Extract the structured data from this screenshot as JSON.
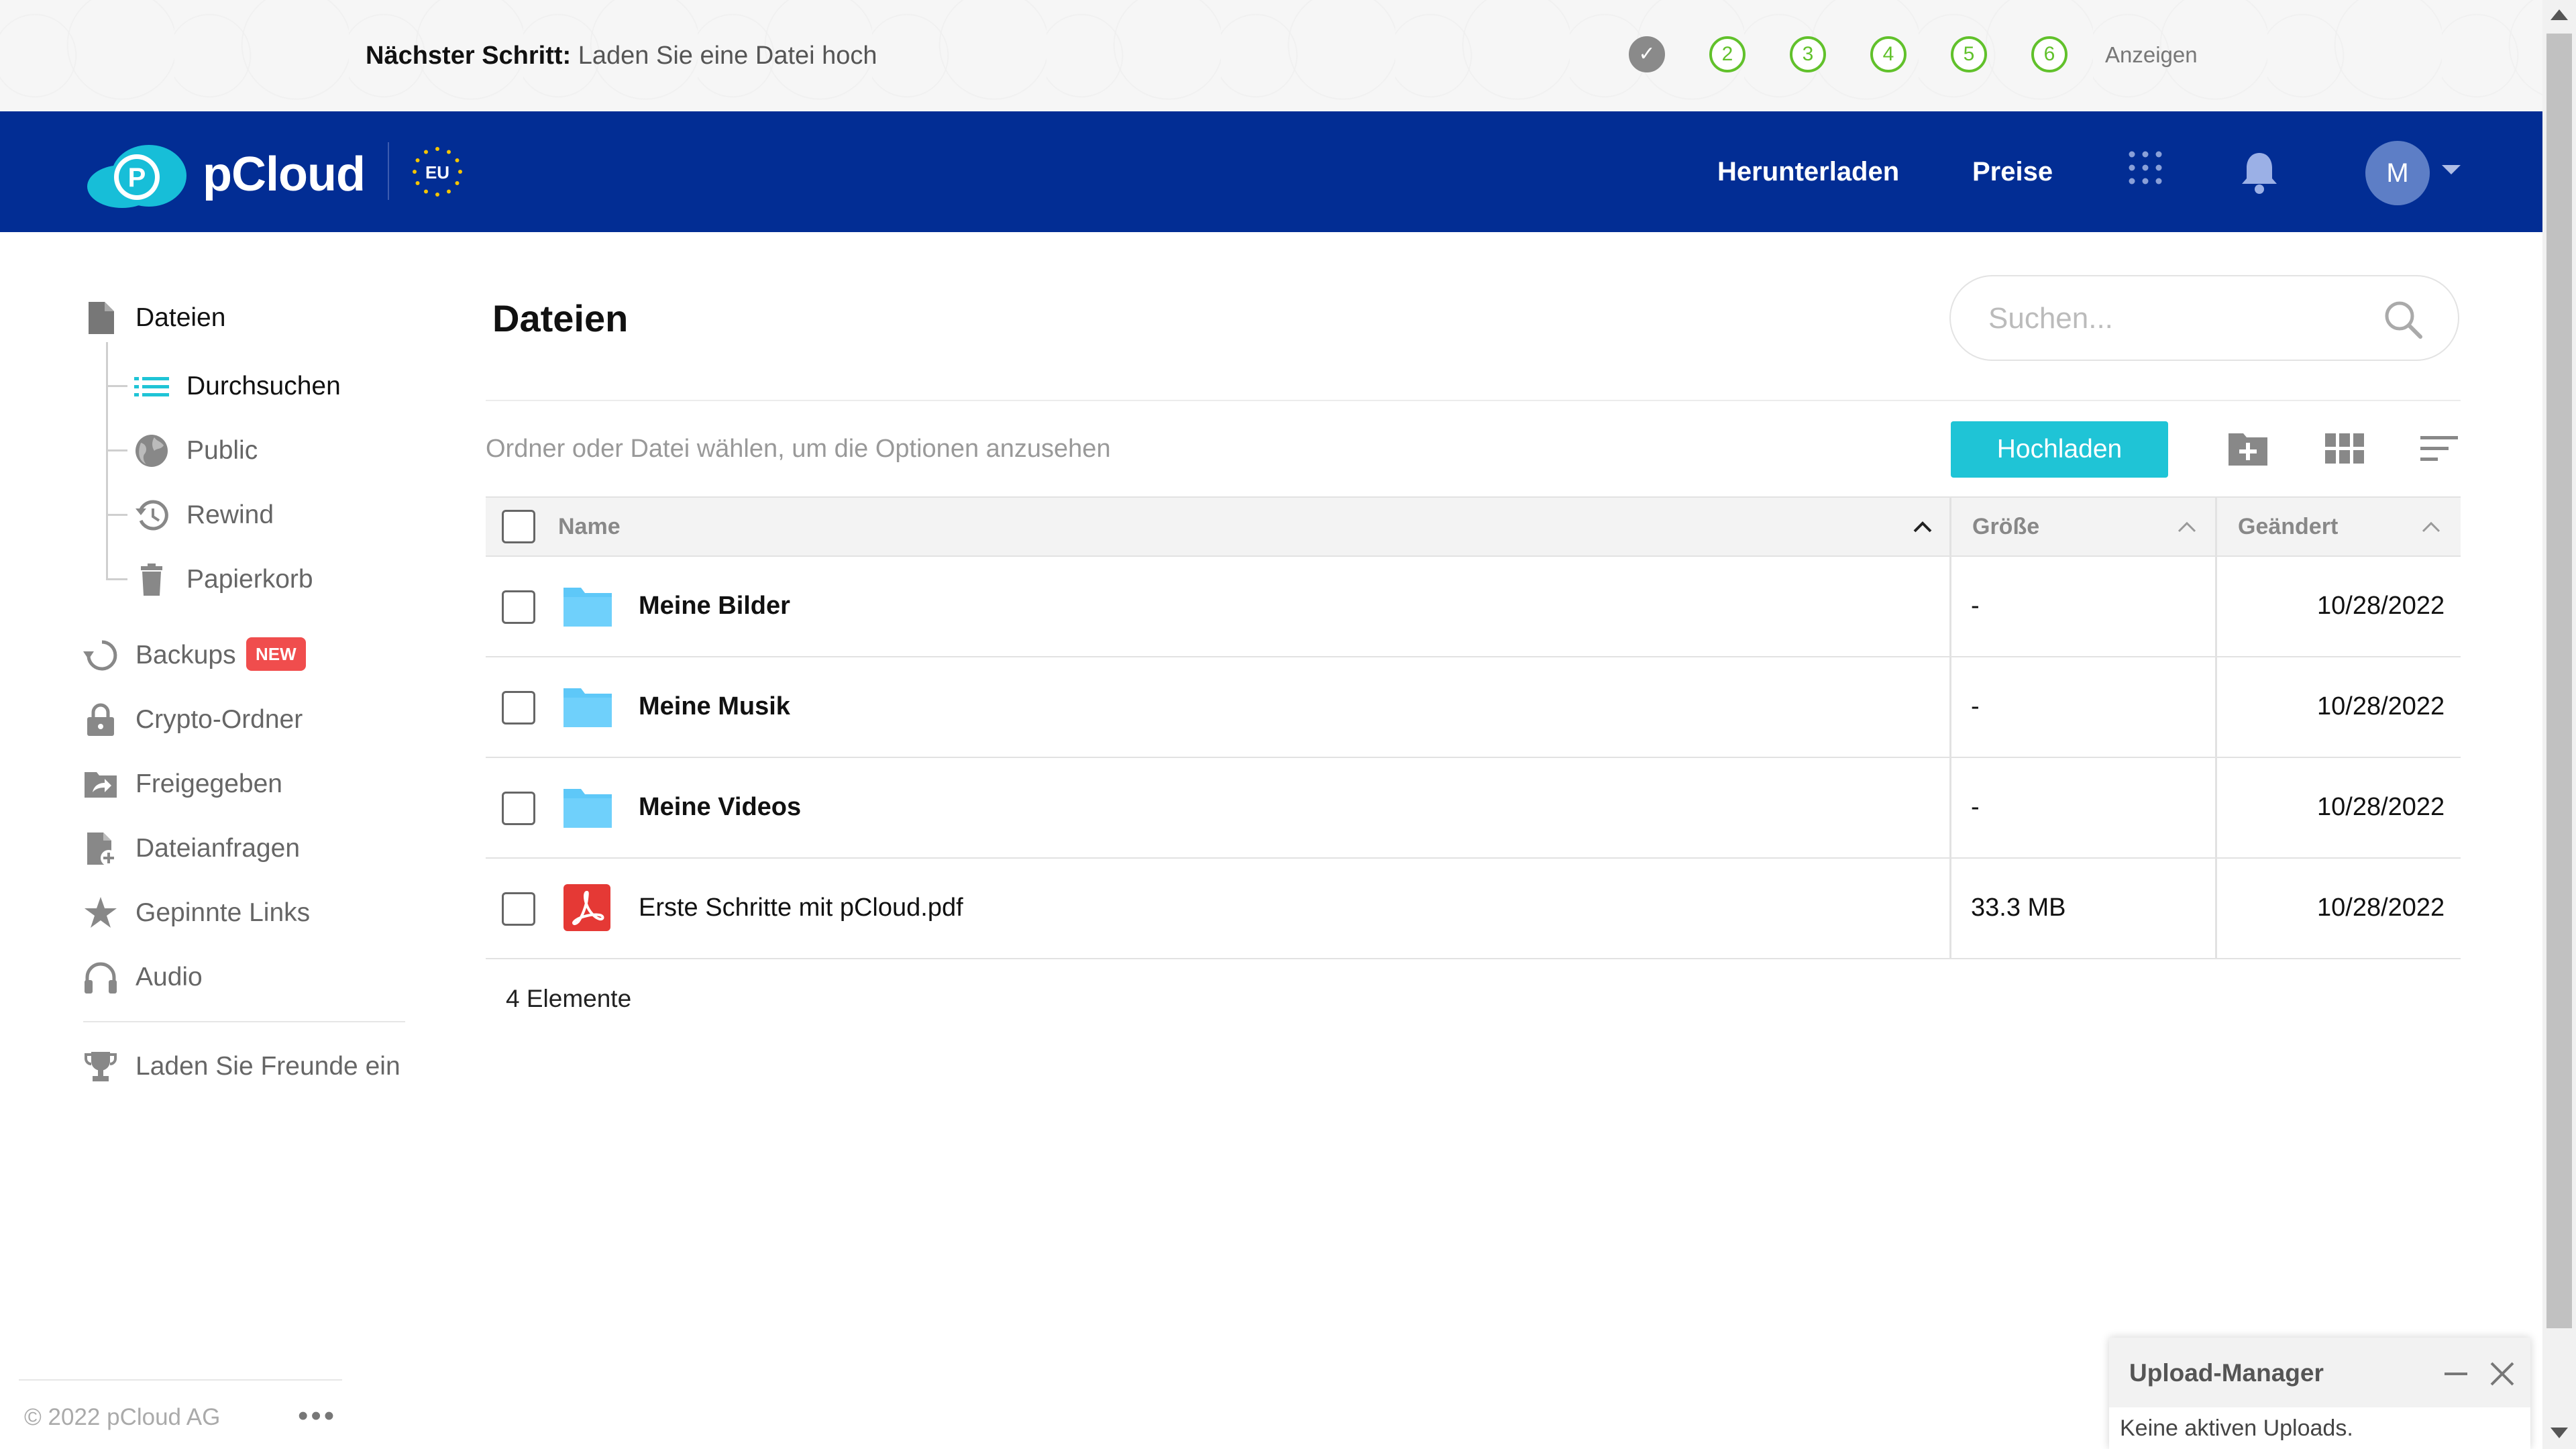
{
  "onboarding": {
    "next_step_label": "Nächster Schritt:",
    "next_step_text": "Laden Sie eine Datei hoch",
    "steps": [
      "✓",
      "2",
      "3",
      "4",
      "5",
      "6"
    ],
    "show_label": "Anzeigen",
    "step_color": "#61c12b"
  },
  "header": {
    "brand": "pCloud",
    "region_badge": "EU",
    "download_label": "Herunterladen",
    "pricing_label": "Preise",
    "avatar_initial": "M",
    "bg_color": "#022d94"
  },
  "sidebar": {
    "files": "Dateien",
    "browse": "Durchsuchen",
    "public": "Public",
    "rewind": "Rewind",
    "trash": "Papierkorb",
    "backups": "Backups",
    "backups_badge": "NEW",
    "crypto": "Crypto-Ordner",
    "shared": "Freigegeben",
    "file_requests": "Dateianfragen",
    "pinned_links": "Gepinnte Links",
    "audio": "Audio",
    "invite": "Laden Sie Freunde ein",
    "footer_copy": "© 2022 pCloud AG",
    "footer_more": "•••"
  },
  "main": {
    "title": "Dateien",
    "search_placeholder": "Suchen...",
    "hint": "Ordner oder Datei wählen, um die Optionen anzusehen",
    "upload_label": "Hochladen",
    "accent": "#1fc4d6",
    "columns": {
      "name": "Name",
      "size": "Größe",
      "modified": "Geändert"
    },
    "rows": [
      {
        "name": "Meine Bilder",
        "type": "folder",
        "size": "-",
        "modified": "10/28/2022"
      },
      {
        "name": "Meine Musik",
        "type": "folder",
        "size": "-",
        "modified": "10/28/2022"
      },
      {
        "name": "Meine Videos",
        "type": "folder",
        "size": "-",
        "modified": "10/28/2022"
      },
      {
        "name": "Erste Schritte mit pCloud.pdf",
        "type": "pdf",
        "size": "33.3 MB",
        "modified": "10/28/2022"
      }
    ],
    "count": "4 Elemente"
  },
  "upload_manager": {
    "title": "Upload-Manager",
    "status": "Keine aktiven Uploads."
  }
}
